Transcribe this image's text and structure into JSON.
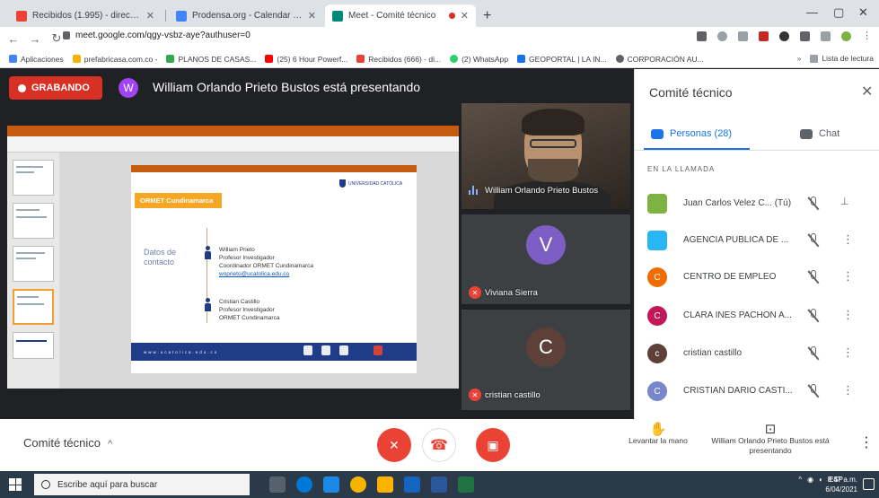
{
  "browser": {
    "tabs": [
      {
        "title": "Recibidos (1.995) - direccion@sv",
        "fav_color": "#ea4335"
      },
      {
        "title": "Prodensa.org - Calendar - Seman",
        "fav_color": "#4285f4"
      },
      {
        "title": "Meet - Comité técnico",
        "fav_color": "#00897b"
      }
    ],
    "new_tab": "+",
    "window_controls": [
      "—",
      "▢",
      "✕"
    ],
    "url": "meet.google.com/qgy-vsbz-aye?authuser=0",
    "bookmarks": [
      {
        "label": "Aplicaciones",
        "color": "#4285f4"
      },
      {
        "label": "prefabricasa.com.co -",
        "color": "#f4b400"
      },
      {
        "label": "PLANOS DE CASAS...",
        "color": "#34a853"
      },
      {
        "label": "(25) 6 Hour Powerf...",
        "color": "#ff0000"
      },
      {
        "label": "Recibidos (666) - di...",
        "color": "#ea4335"
      },
      {
        "label": "(2) WhatsApp",
        "color": "#25d366"
      },
      {
        "label": "GEOPORTAL | LA IN...",
        "color": "#1a73e8"
      },
      {
        "label": "CORPORACIÓN AU...",
        "color": "#5f6368"
      }
    ],
    "reading_list": "Lista de lectura"
  },
  "meet": {
    "recording_label": "GRABANDO",
    "presenter_initial": "W",
    "presenting_text": "William Orlando Prieto Bustos está presentando",
    "slide": {
      "org_label": "ORMET Cundinamarca",
      "logo_text": "UNIVERSIDAD CATÓLICA",
      "contact_heading": "Datos de contacto",
      "people": [
        {
          "name": "William Prieto",
          "role": "Profesor Investigador",
          "role2": "Coordinador ORMET Cundinamarca",
          "email": "woprieto@ucatolica.edu.co"
        },
        {
          "name": "Cristian Castillo",
          "role": "Profesor Investigador",
          "role2": "ORMET Cundinamarca",
          "email": ""
        }
      ],
      "footer": "www.ucatolica.edu.co"
    },
    "tiles": [
      {
        "name": "William Orlando Prieto Bustos"
      },
      {
        "name": "Viviana Sierra",
        "initial": "V",
        "color": "#7b5dc4"
      },
      {
        "name": "cristian castillo",
        "initial": "C",
        "color": "#5d4037"
      }
    ],
    "meeting_name": "Comité técnico",
    "chevron": "^",
    "raise_hand_label": "Levantar la mano",
    "presenting_status": "William Orlando Prieto Bustos está presentando"
  },
  "panel": {
    "title": "Comité técnico",
    "close_icon": "close-icon",
    "tab_people": "Personas (28)",
    "tab_chat": "Chat",
    "section_label": "EN LA LLAMADA",
    "participants": [
      {
        "name": "Juan Carlos Velez C... (Tú)",
        "initial": "",
        "color": "#7cb342"
      },
      {
        "name": "AGENCIA PÚBLICA DE ...",
        "initial": "",
        "color": "#29b6f6"
      },
      {
        "name": "CENTRO DE EMPLEO",
        "initial": "C",
        "color": "#ef6c00"
      },
      {
        "name": "CLARA INES PACHON A...",
        "initial": "C",
        "color": "#c2185b"
      },
      {
        "name": "cristian castillo",
        "initial": "c",
        "color": "#5d4037"
      },
      {
        "name": "CRISTIAN DARIO CASTI...",
        "initial": "C",
        "color": "#7986cb"
      }
    ]
  },
  "taskbar": {
    "search_placeholder": "Escribe aquí para buscar",
    "tray_lang": "ESP",
    "time": "8:47 a.m.",
    "date": "6/04/2021"
  }
}
